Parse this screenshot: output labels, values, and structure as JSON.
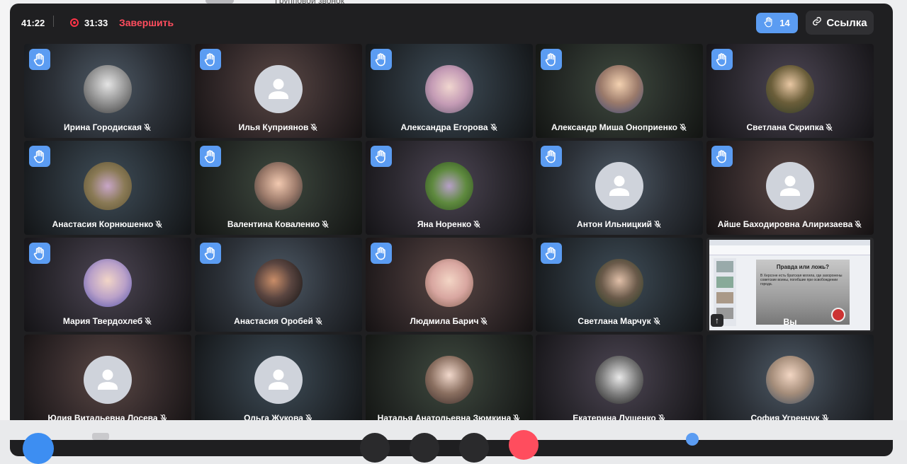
{
  "background": {
    "header_text": "Групповой звонок"
  },
  "topbar": {
    "call_time": "41:22",
    "record_time": "31:33",
    "end_label": "Завершить",
    "raised_hands_count": "14",
    "link_label": "Ссылка"
  },
  "participants": [
    "Ирина Городиская",
    "Илья Куприянов",
    "Александра Егорова",
    "Александр Миша Оноприенко",
    "Светлана Скрипка",
    "Анастасия Корнюшенко",
    "Валентина Коваленко",
    "Яна Норенко",
    "Антон Ильницкий",
    "Айше Баходировна Алиризаева",
    "Мария Твердохлеб",
    "Анастасия Оробей",
    "Людмила Барич",
    "Светлана Марчук",
    "Вы",
    "Юлия Витальевна Лосева",
    "Ольга Жукова",
    "Наталья Анатольевна Зюмкина",
    "Екатерина Лущенко",
    "София Угренчук"
  ],
  "screen_share": {
    "slide_title": "Правда или ложь?",
    "slide_text": "В Херсоне есть братская могила, где захоронены советские воины, погибшие при освобождении города."
  },
  "colors": {
    "accent": "#5b9cf2",
    "danger": "#ff4d5e",
    "window_bg": "#1f1f21"
  },
  "icons": [
    "raised-hand-icon",
    "muted-mic-icon",
    "link-icon",
    "record-icon",
    "user-placeholder-icon"
  ]
}
